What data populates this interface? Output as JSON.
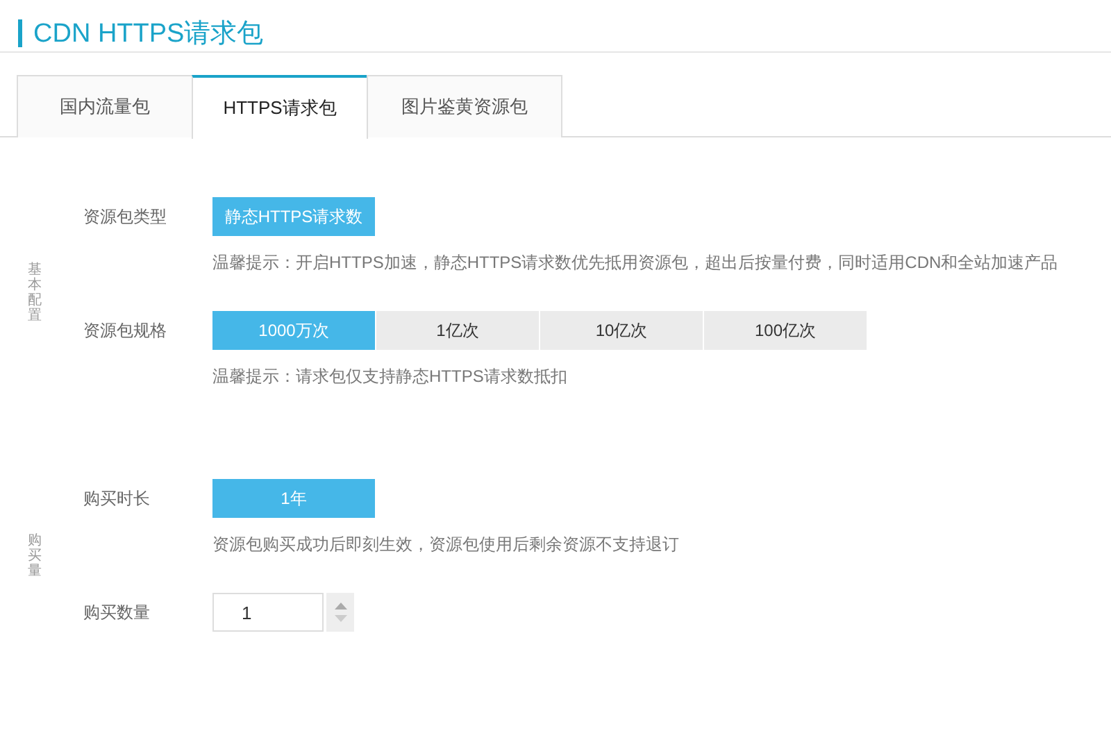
{
  "title": "CDN HTTPS请求包",
  "tabs": [
    {
      "label": "国内流量包",
      "selected": false
    },
    {
      "label": "HTTPS请求包",
      "selected": true
    },
    {
      "label": "图片鉴黄资源包",
      "selected": false
    }
  ],
  "sections": [
    {
      "label": "基本配置",
      "rows": [
        {
          "kind": "options",
          "label": "资源包类型",
          "options": [
            {
              "label": "静态HTTPS请求数",
              "selected": true
            }
          ],
          "hint": "温馨提示：开启HTTPS加速，静态HTTPS请求数优先抵用资源包，超出后按量付费，同时适用CDN和全站加速产品"
        },
        {
          "kind": "options",
          "label": "资源包规格",
          "options": [
            {
              "label": "1000万次",
              "selected": true
            },
            {
              "label": "1亿次",
              "selected": false
            },
            {
              "label": "10亿次",
              "selected": false
            },
            {
              "label": "100亿次",
              "selected": false
            }
          ],
          "hint": "温馨提示：请求包仅支持静态HTTPS请求数抵扣"
        }
      ]
    },
    {
      "label": "购买量",
      "rows": [
        {
          "kind": "options",
          "label": "购买时长",
          "options": [
            {
              "label": "1年",
              "selected": true
            }
          ],
          "hint": "资源包购买成功后即刻生效，资源包使用后剩余资源不支持退订"
        },
        {
          "kind": "stepper",
          "label": "购买数量",
          "value": "1"
        }
      ]
    }
  ]
}
